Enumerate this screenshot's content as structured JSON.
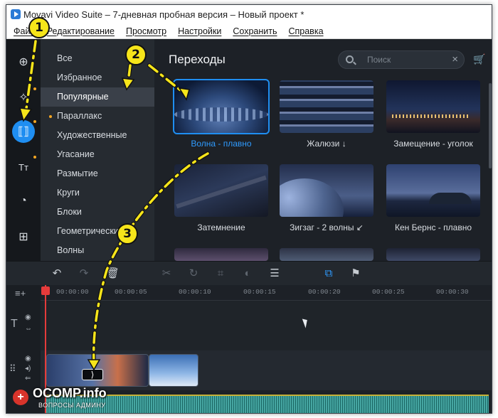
{
  "window": {
    "title": "Movavi Video Suite – 7-дневная пробная версия – Новый проект *"
  },
  "menu": [
    "Файл",
    "Редактирование",
    "Просмотр",
    "Настройки",
    "Сохранить",
    "Справка"
  ],
  "rail": {
    "items": [
      {
        "icon": "import-icon",
        "glyph": "⊕"
      },
      {
        "icon": "magic-wand-icon",
        "glyph": "✧"
      },
      {
        "icon": "transitions-icon",
        "glyph": "⟦⟧"
      },
      {
        "icon": "titles-icon",
        "glyph": "Tт"
      },
      {
        "icon": "stickers-icon",
        "glyph": "◔"
      },
      {
        "icon": "more-tools-icon",
        "glyph": "⊞"
      }
    ],
    "active_index": 2
  },
  "categories": {
    "items": [
      "Все",
      "Избранное",
      "Популярные",
      "Параллакс",
      "Художественные",
      "Угасание",
      "Размытие",
      "Круги",
      "Блоки",
      "Геометрические",
      "Волны"
    ],
    "selected_index": 2,
    "dotted_index": 3
  },
  "content": {
    "title": "Переходы",
    "search_placeholder": "Поиск",
    "tiles": [
      {
        "label": "Волна - плавно",
        "selected": true
      },
      {
        "label": "Жалюзи ↓",
        "selected": false
      },
      {
        "label": "Замещение - уголок",
        "selected": false
      },
      {
        "label": "Затемнение",
        "selected": false
      },
      {
        "label": "Зигзаг - 2 волны ↙",
        "selected": false
      },
      {
        "label": "Кен Бернс - плавно",
        "selected": false
      }
    ]
  },
  "timeline": {
    "ticks": [
      "00:00:00",
      "00:00:05",
      "00:00:10",
      "00:00:15",
      "00:00:20",
      "00:00:25",
      "00:00:30"
    ]
  },
  "annotations": {
    "numbers": [
      "1",
      "2",
      "3"
    ],
    "color": "#f6e51a"
  },
  "watermark": {
    "title": "OCOMP.info",
    "subtitle": "ВОПРОСЫ АДМИНУ"
  },
  "colors": {
    "accent": "#1f8ef1",
    "playhead": "#e53b3b",
    "rail_dot": "#f5a623"
  }
}
